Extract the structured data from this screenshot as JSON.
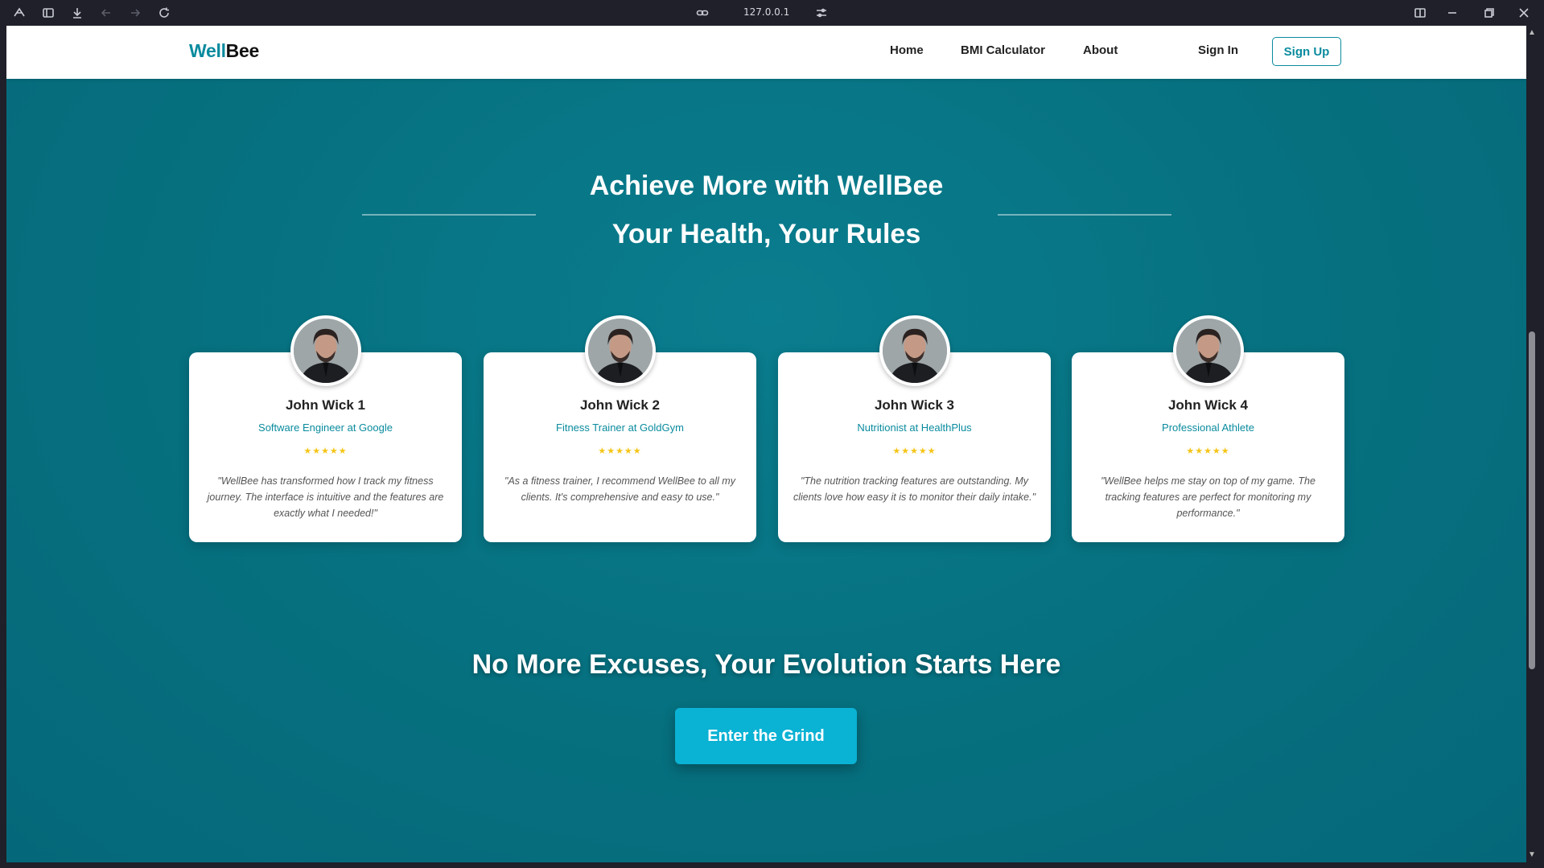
{
  "browser": {
    "url": "127.0.0.1"
  },
  "nav": {
    "logo_part1": "Well",
    "logo_part2": "Bee",
    "links": [
      "Home",
      "BMI Calculator",
      "About"
    ],
    "sign_in": "Sign In",
    "sign_up": "Sign Up"
  },
  "hero": {
    "title": "Achieve More with WellBee",
    "subtitle": "Your Health, Your Rules"
  },
  "testimonials": [
    {
      "name": "John Wick 1",
      "role": "Software Engineer at Google",
      "stars": "★★★★★",
      "quote": "\"WellBee has transformed how I track my fitness journey. The interface is intuitive and the features are exactly what I needed!\""
    },
    {
      "name": "John Wick 2",
      "role": "Fitness Trainer at GoldGym",
      "stars": "★★★★★",
      "quote": "\"As a fitness trainer, I recommend WellBee to all my clients. It's comprehensive and easy to use.\""
    },
    {
      "name": "John Wick 3",
      "role": "Nutritionist at HealthPlus",
      "stars": "★★★★★",
      "quote": "\"The nutrition tracking features are outstanding. My clients love how easy it is to monitor their daily intake.\""
    },
    {
      "name": "John Wick 4",
      "role": "Professional Athlete",
      "stars": "★★★★★",
      "quote": "\"WellBee helps me stay on top of my game. The tracking features are perfect for monitoring my performance.\""
    }
  ],
  "cta": {
    "title": "No More Excuses, Your Evolution Starts Here",
    "button": "Enter the Grind"
  },
  "colors": {
    "brand_teal": "#0a8b9e",
    "hero_bg": "#06707f",
    "cta_button": "#0ab2d4",
    "star": "#f5c518"
  }
}
